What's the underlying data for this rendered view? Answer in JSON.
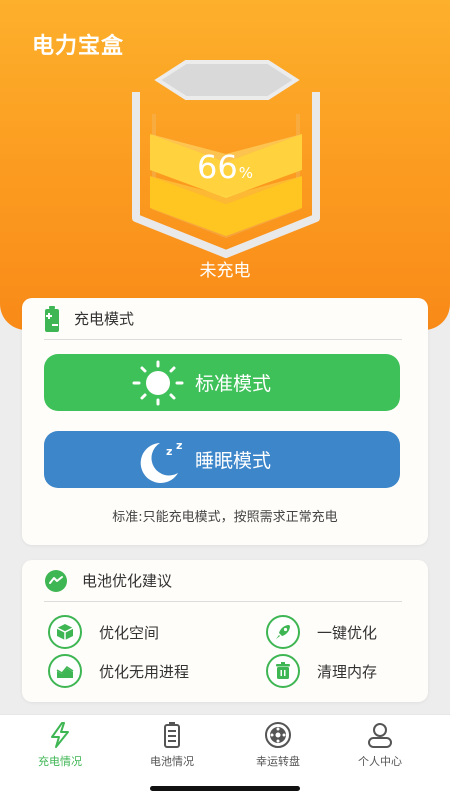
{
  "app": {
    "title": "电力宝盒"
  },
  "battery": {
    "percent": "66",
    "percent_sign": "%",
    "status": "未充电",
    "level": 0.66
  },
  "charge_mode": {
    "title": "充电模式",
    "standard_label": "标准模式",
    "sleep_label": "睡眠模式",
    "hint": "标准:只能充电模式，按照需求正常充电"
  },
  "optimize": {
    "title": "电池优化建议",
    "items": [
      {
        "label": "优化空间",
        "icon": "box-icon"
      },
      {
        "label": "一键优化",
        "icon": "rocket-icon"
      },
      {
        "label": "优化无用进程",
        "icon": "chart-icon"
      },
      {
        "label": "清理内存",
        "icon": "trash-icon"
      }
    ]
  },
  "tabs": [
    {
      "label": "充电情况",
      "icon": "lightning-icon",
      "active": true
    },
    {
      "label": "电池情况",
      "icon": "battery-icon",
      "active": false
    },
    {
      "label": "幸运转盘",
      "icon": "wheel-icon",
      "active": false
    },
    {
      "label": "个人中心",
      "icon": "person-icon",
      "active": false
    }
  ],
  "colors": {
    "accent_orange": "#fb9a1f",
    "green": "#3fc15a",
    "blue": "#3c86c9"
  }
}
